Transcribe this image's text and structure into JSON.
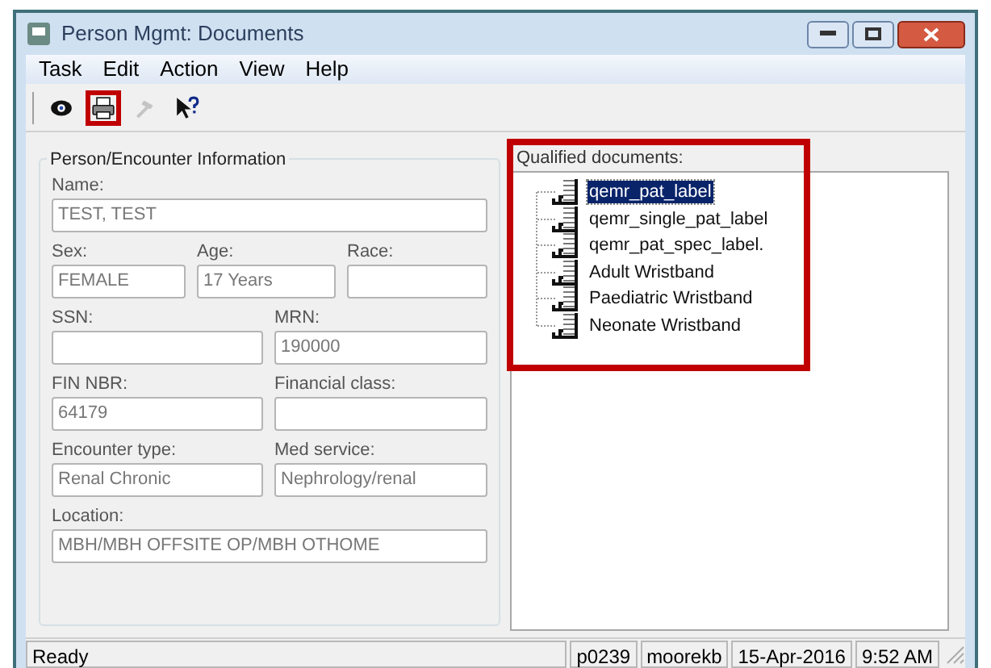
{
  "window": {
    "title": "Person Mgmt: Documents"
  },
  "menu": [
    "Task",
    "Edit",
    "Action",
    "View",
    "Help"
  ],
  "toolbar": [
    {
      "kind": "eye",
      "highlighted": false,
      "disabled": false
    },
    {
      "kind": "print",
      "highlighted": true,
      "disabled": false
    },
    {
      "kind": "hammer",
      "highlighted": false,
      "disabled": true
    },
    {
      "kind": "help",
      "highlighted": false,
      "disabled": false
    }
  ],
  "info": {
    "title": "Person/Encounter Information",
    "rows": [
      [
        {
          "label": "Name:",
          "value": "TEST, TEST"
        }
      ],
      [
        {
          "label": "Sex:",
          "value": "FEMALE"
        },
        {
          "label": "Age:",
          "value": "17 Years"
        },
        {
          "label": "Race:"
        }
      ],
      [
        {
          "label": "SSN:"
        },
        {
          "label": "MRN:",
          "value": "190000"
        }
      ],
      [
        {
          "label": "FIN NBR:",
          "value": "64179"
        },
        {
          "label": "Financial class:"
        }
      ],
      [
        {
          "label": "Encounter type:",
          "value": "Renal Chronic"
        },
        {
          "label": "Med service:",
          "value": "Nephrology/renal"
        }
      ],
      [
        {
          "label": "Location:",
          "value": "MBH/MBH OFFSITE OP/MBH OTHOME"
        }
      ]
    ]
  },
  "documents": {
    "title": "Qualified documents:",
    "highlighted": true,
    "items": [
      {
        "label": "qemr_pat_label",
        "selected": true
      },
      {
        "label": "qemr_single_pat_label",
        "selected": false
      },
      {
        "label": "qemr_pat_spec_label.",
        "selected": false
      },
      {
        "label": "Adult Wristband",
        "selected": false
      },
      {
        "label": "Paediatric Wristband",
        "selected": false
      },
      {
        "label": "Neonate Wristband",
        "selected": false
      }
    ]
  },
  "status_bar": {
    "message": "Ready",
    "panes": [
      "p0239",
      "moorekb",
      "15-Apr-2016",
      "9:52 AM"
    ]
  }
}
